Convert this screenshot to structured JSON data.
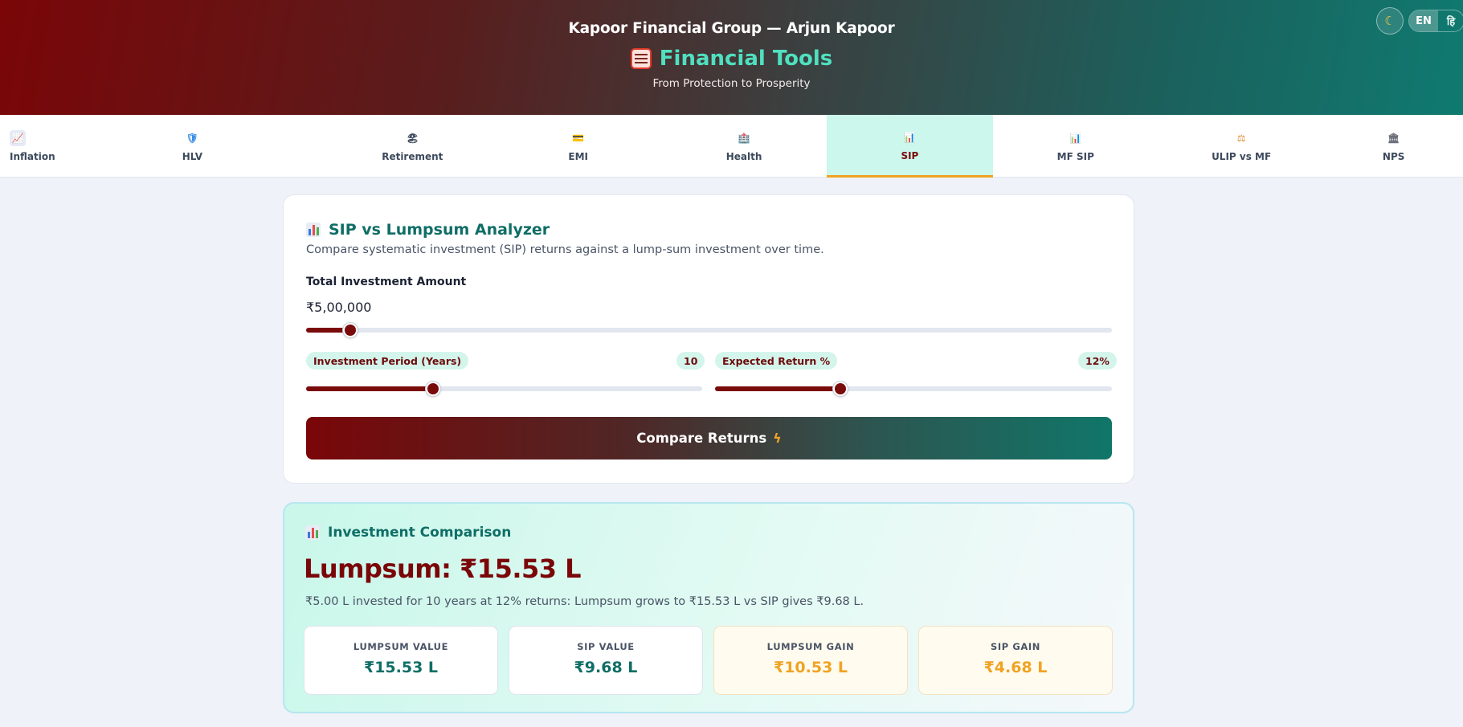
{
  "header": {
    "brand": "Kapoor Financial Group — Arjun Kapoor",
    "title": "Financial Tools",
    "tagline": "From Protection to Prosperity",
    "theme_icon": "☾",
    "lang_active": "EN",
    "lang_other": "हि"
  },
  "tabs": [
    {
      "label": "Inflation",
      "icon": "📈"
    },
    {
      "label": "HLV",
      "icon": "🛡"
    },
    {
      "label": "Retirement",
      "icon": "🏖"
    },
    {
      "label": "EMI",
      "icon": "💳"
    },
    {
      "label": "Health",
      "icon": "🏥"
    },
    {
      "label": "SIP",
      "icon": "📊",
      "active": true
    },
    {
      "label": "MF SIP",
      "icon": "📊"
    },
    {
      "label": "ULIP vs MF",
      "icon": "⚖"
    },
    {
      "label": "NPS",
      "icon": "🏛"
    }
  ],
  "analyzer": {
    "title": "SIP vs Lumpsum Analyzer",
    "description": "Compare systematic investment (SIP) returns against a lump-sum investment over time.",
    "amount_label": "Total Investment Amount",
    "amount_value": "₹5,00,000",
    "period_label": "Investment Period (Years)",
    "period_value": "10",
    "return_label": "Expected Return %",
    "return_value": "12%",
    "button_label": "Compare Returns",
    "button_icon": "ϟ"
  },
  "sliders": {
    "amount_fraction": 0.055,
    "period_fraction": 0.32,
    "return_fraction": 0.315
  },
  "results": {
    "title": "Investment Comparison",
    "headline": "Lumpsum: ₹15.53 L",
    "summary": "₹5.00 L invested for 10 years at 12% returns: Lumpsum grows to ₹15.53 L vs SIP gives ₹9.68 L.",
    "metrics": [
      {
        "label": "LUMPSUM VALUE",
        "value": "₹15.53 L"
      },
      {
        "label": "SIP VALUE",
        "value": "₹9.68 L"
      },
      {
        "label": "LUMPSUM GAIN",
        "value": "₹10.53 L"
      },
      {
        "label": "SIP GAIN",
        "value": "₹4.68 L"
      }
    ]
  }
}
